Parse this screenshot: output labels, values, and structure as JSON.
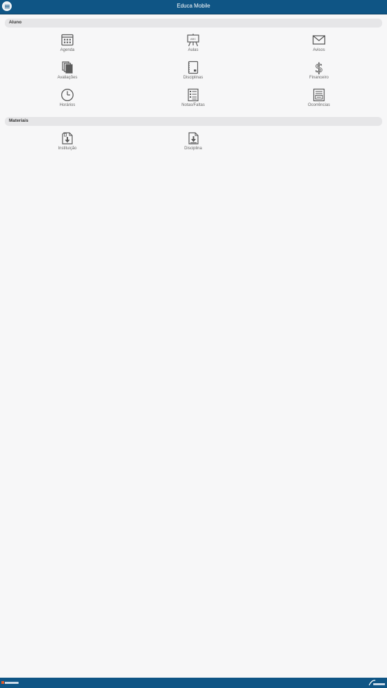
{
  "header": {
    "title": "Educa Mobile"
  },
  "sections": {
    "aluno": {
      "title": "Aluno",
      "items": [
        {
          "label": "Agenda"
        },
        {
          "label": "Aulas"
        },
        {
          "label": "Avisos"
        },
        {
          "label": "Avaliações"
        },
        {
          "label": "Disciplinas"
        },
        {
          "label": "Financeiro"
        },
        {
          "label": "Horários"
        },
        {
          "label": "Notas/Faltas"
        },
        {
          "label": "Ocorrências"
        }
      ]
    },
    "materiais": {
      "title": "Materiais",
      "items": [
        {
          "label": "Instituição"
        },
        {
          "label": "Disciplina"
        }
      ]
    }
  },
  "colors": {
    "header": "#0f5585",
    "icon": "#5a5a5a",
    "section_bg": "#e6e6e8",
    "page_bg": "#f7f7f8"
  },
  "icons": [
    "calendar-icon",
    "whiteboard-icon",
    "envelope-icon",
    "documents-icon",
    "notebook-icon",
    "dollar-icon",
    "clock-icon",
    "checklist-icon",
    "report-icon",
    "download-doc-icon"
  ]
}
